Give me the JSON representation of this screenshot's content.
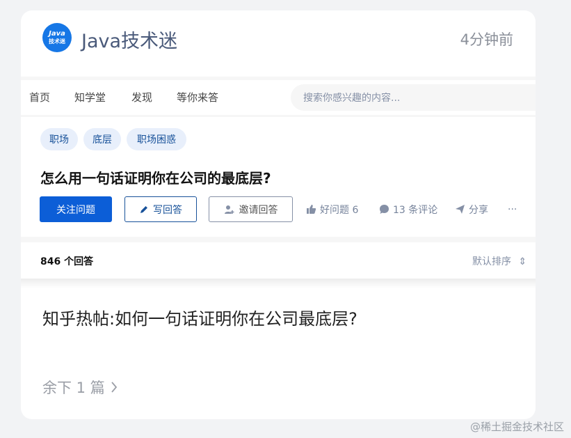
{
  "header": {
    "logo_line1": "Java",
    "logo_line2": "技术迷",
    "account_name": "Java技术迷",
    "time_ago": "4分钟前"
  },
  "screenshot": {
    "nav": [
      "首页",
      "知学堂",
      "发现",
      "等你来答"
    ],
    "search_placeholder": "搜索你感兴趣的内容...",
    "tags": [
      "职场",
      "底层",
      "职场困惑"
    ],
    "question_title": "怎么用一句话证明你在公司的最底层?",
    "buttons": {
      "follow": "关注问题",
      "write": "写回答",
      "invite": "邀请回答"
    },
    "actions": {
      "good_question": "好问题 6",
      "comments": "13 条评论",
      "share": "分享",
      "more": "···"
    },
    "answer_count": "846 个回答",
    "sort": "默认排序"
  },
  "article": {
    "title": "知乎热帖:如何一句话证明你在公司最底层?",
    "remaining": "余下 1 篇"
  },
  "watermark": "@稀土掘金技术社区",
  "colors": {
    "primary_blue": "#0c5ed7",
    "tag_bg": "#e8effb",
    "tag_text": "#175199",
    "logo_blue": "#1677e6"
  }
}
